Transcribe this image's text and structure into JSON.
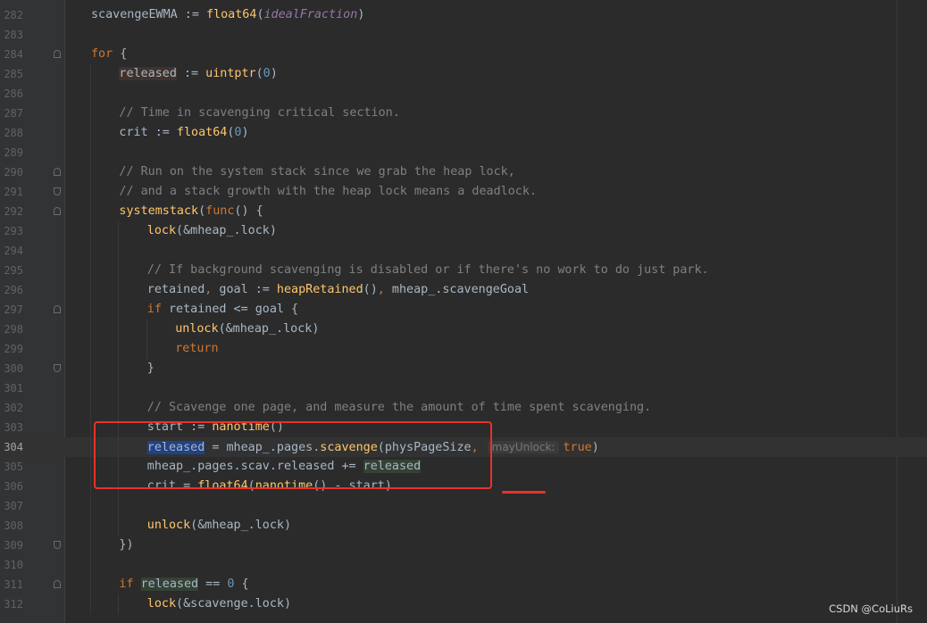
{
  "editor": {
    "lines": [
      {
        "n": "282",
        "fold": "",
        "tokens": [
          [
            "scavengeEWMA := ",
            "p"
          ],
          [
            "float64",
            "fn"
          ],
          [
            "(",
            "p"
          ],
          [
            "idealFraction",
            "it"
          ],
          [
            ")",
            "p"
          ]
        ]
      },
      {
        "n": "283",
        "fold": "",
        "tokens": []
      },
      {
        "n": "284",
        "fold": "start",
        "tokens": [
          [
            "for",
            "kw"
          ],
          [
            " {",
            "p"
          ]
        ]
      },
      {
        "n": "285",
        "fold": "",
        "tokens": [
          [
            "released",
            "hl-decl"
          ],
          [
            " := ",
            "p"
          ],
          [
            "uintptr",
            "fn"
          ],
          [
            "(",
            "p"
          ],
          [
            "0",
            "num"
          ],
          [
            ")",
            "p"
          ]
        ]
      },
      {
        "n": "286",
        "fold": "",
        "tokens": []
      },
      {
        "n": "287",
        "fold": "",
        "tokens": [
          [
            "// Time in scavenging critical section.",
            "cm"
          ]
        ]
      },
      {
        "n": "288",
        "fold": "",
        "tokens": [
          [
            "crit := ",
            "p"
          ],
          [
            "float64",
            "fn"
          ],
          [
            "(",
            "p"
          ],
          [
            "0",
            "num"
          ],
          [
            ")",
            "p"
          ]
        ]
      },
      {
        "n": "289",
        "fold": "",
        "tokens": []
      },
      {
        "n": "290",
        "fold": "start",
        "tokens": [
          [
            "// Run on the system stack since we grab the heap lock,",
            "cm"
          ]
        ]
      },
      {
        "n": "291",
        "fold": "end",
        "tokens": [
          [
            "// and a stack growth with the heap lock means a deadlock.",
            "cm"
          ]
        ]
      },
      {
        "n": "292",
        "fold": "start",
        "tokens": [
          [
            "systemstack",
            "fn"
          ],
          [
            "(",
            "p"
          ],
          [
            "func",
            "kw"
          ],
          [
            "() {",
            "p"
          ]
        ]
      },
      {
        "n": "293",
        "fold": "",
        "tokens": [
          [
            "lock",
            "fn"
          ],
          [
            "(&mheap_.lock)",
            "p"
          ]
        ]
      },
      {
        "n": "294",
        "fold": "",
        "tokens": []
      },
      {
        "n": "295",
        "fold": "",
        "tokens": [
          [
            "// If background scavenging is disabled or if there's no work to do just park.",
            "cm"
          ]
        ]
      },
      {
        "n": "296",
        "fold": "",
        "tokens": [
          [
            "retained",
            "p"
          ],
          [
            ",",
            "kw"
          ],
          [
            " goal := ",
            "p"
          ],
          [
            "heapRetained",
            "fn"
          ],
          [
            "()",
            "p"
          ],
          [
            ",",
            "kw"
          ],
          [
            " mheap_.scavengeGoal",
            "p"
          ]
        ]
      },
      {
        "n": "297",
        "fold": "start",
        "tokens": [
          [
            "if",
            "kw"
          ],
          [
            " retained <= goal {",
            "p"
          ]
        ]
      },
      {
        "n": "298",
        "fold": "",
        "tokens": [
          [
            "unlock",
            "fn"
          ],
          [
            "(&mheap_.lock)",
            "p"
          ]
        ]
      },
      {
        "n": "299",
        "fold": "",
        "tokens": [
          [
            "return",
            "kw"
          ]
        ]
      },
      {
        "n": "300",
        "fold": "end",
        "tokens": [
          [
            "}",
            "p"
          ]
        ]
      },
      {
        "n": "301",
        "fold": "",
        "tokens": []
      },
      {
        "n": "302",
        "fold": "",
        "tokens": [
          [
            "// Scavenge one page, and measure the amount of time spent scavenging.",
            "cm"
          ]
        ]
      },
      {
        "n": "303",
        "fold": "",
        "tokens": [
          [
            "start := ",
            "p"
          ],
          [
            "nanotime",
            "fn"
          ],
          [
            "()",
            "p"
          ]
        ]
      },
      {
        "n": "304",
        "fold": "",
        "current": true,
        "tokens": [
          [
            "released",
            "hl-write"
          ],
          [
            " = mheap_.pages.",
            "p"
          ],
          [
            "scavenge",
            "fn"
          ],
          [
            "(physPageSize",
            "p"
          ],
          [
            ",",
            "kw"
          ],
          [
            "mayUnlock:",
            "hint"
          ],
          [
            "true",
            "kw"
          ],
          [
            ")",
            "p"
          ]
        ]
      },
      {
        "n": "305",
        "fold": "",
        "tokens": [
          [
            "mheap_.pages.scav.released += ",
            "p"
          ],
          [
            "released",
            "hl-read"
          ]
        ]
      },
      {
        "n": "306",
        "fold": "",
        "tokens": [
          [
            "crit = ",
            "p"
          ],
          [
            "float64",
            "fn"
          ],
          [
            "(",
            "p"
          ],
          [
            "nanotime",
            "fn"
          ],
          [
            "() - start)",
            "p"
          ]
        ]
      },
      {
        "n": "307",
        "fold": "",
        "tokens": []
      },
      {
        "n": "308",
        "fold": "",
        "tokens": [
          [
            "unlock",
            "fn"
          ],
          [
            "(&mheap_.lock)",
            "p"
          ]
        ]
      },
      {
        "n": "309",
        "fold": "end",
        "tokens": [
          [
            "})",
            "p"
          ]
        ]
      },
      {
        "n": "310",
        "fold": "",
        "tokens": []
      },
      {
        "n": "311",
        "fold": "start",
        "tokens": [
          [
            "if",
            "kw"
          ],
          [
            " ",
            "p"
          ],
          [
            "released",
            "hl-read"
          ],
          [
            " == ",
            "p"
          ],
          [
            "0",
            "num"
          ],
          [
            " {",
            "p"
          ]
        ]
      },
      {
        "n": "312",
        "fold": "",
        "tokens": [
          [
            "lock",
            "fn"
          ],
          [
            "(&scavenge.lock)",
            "p"
          ]
        ]
      }
    ]
  },
  "watermark": "CSDN @CoLiuRs",
  "colors": {
    "background": "#2b2b2b",
    "gutter": "#313335",
    "keyword": "#cc7832",
    "function": "#ffc66d",
    "number": "#6897bb",
    "comment": "#808080",
    "annotation": "#e8322b"
  }
}
